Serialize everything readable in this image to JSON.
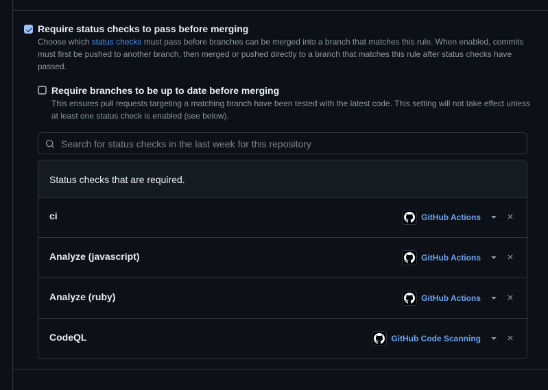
{
  "require_status_checks": {
    "checked": true,
    "title": "Require status checks to pass before merging",
    "desc_before_link": "Choose which ",
    "link_text": "status checks",
    "desc_after_link": " must pass before branches can be merged into a branch that matches this rule. When enabled, commits must first be pushed to another branch, then merged or pushed directly to a branch that matches this rule after status checks have passed."
  },
  "require_up_to_date": {
    "checked": false,
    "title": "Require branches to be up to date before merging",
    "desc": "This ensures pull requests targeting a matching branch have been tested with the latest code. This setting will not take effect unless at least one status check is enabled (see below)."
  },
  "search": {
    "placeholder": "Search for status checks in the last week for this repository",
    "value": ""
  },
  "required_checks": {
    "header": "Status checks that are required.",
    "items": [
      {
        "name": "ci",
        "app": "GitHub Actions",
        "icon": "github-mark-icon"
      },
      {
        "name": "Analyze (javascript)",
        "app": "GitHub Actions",
        "icon": "github-mark-icon"
      },
      {
        "name": "Analyze (ruby)",
        "app": "GitHub Actions",
        "icon": "github-mark-icon"
      },
      {
        "name": "CodeQL",
        "app": "GitHub Code Scanning",
        "icon": "github-mark-icon"
      }
    ]
  },
  "colors": {
    "background": "#0d1117",
    "link": "#4493f8",
    "app_link": "#6ca3f2",
    "border": "#30363d"
  }
}
